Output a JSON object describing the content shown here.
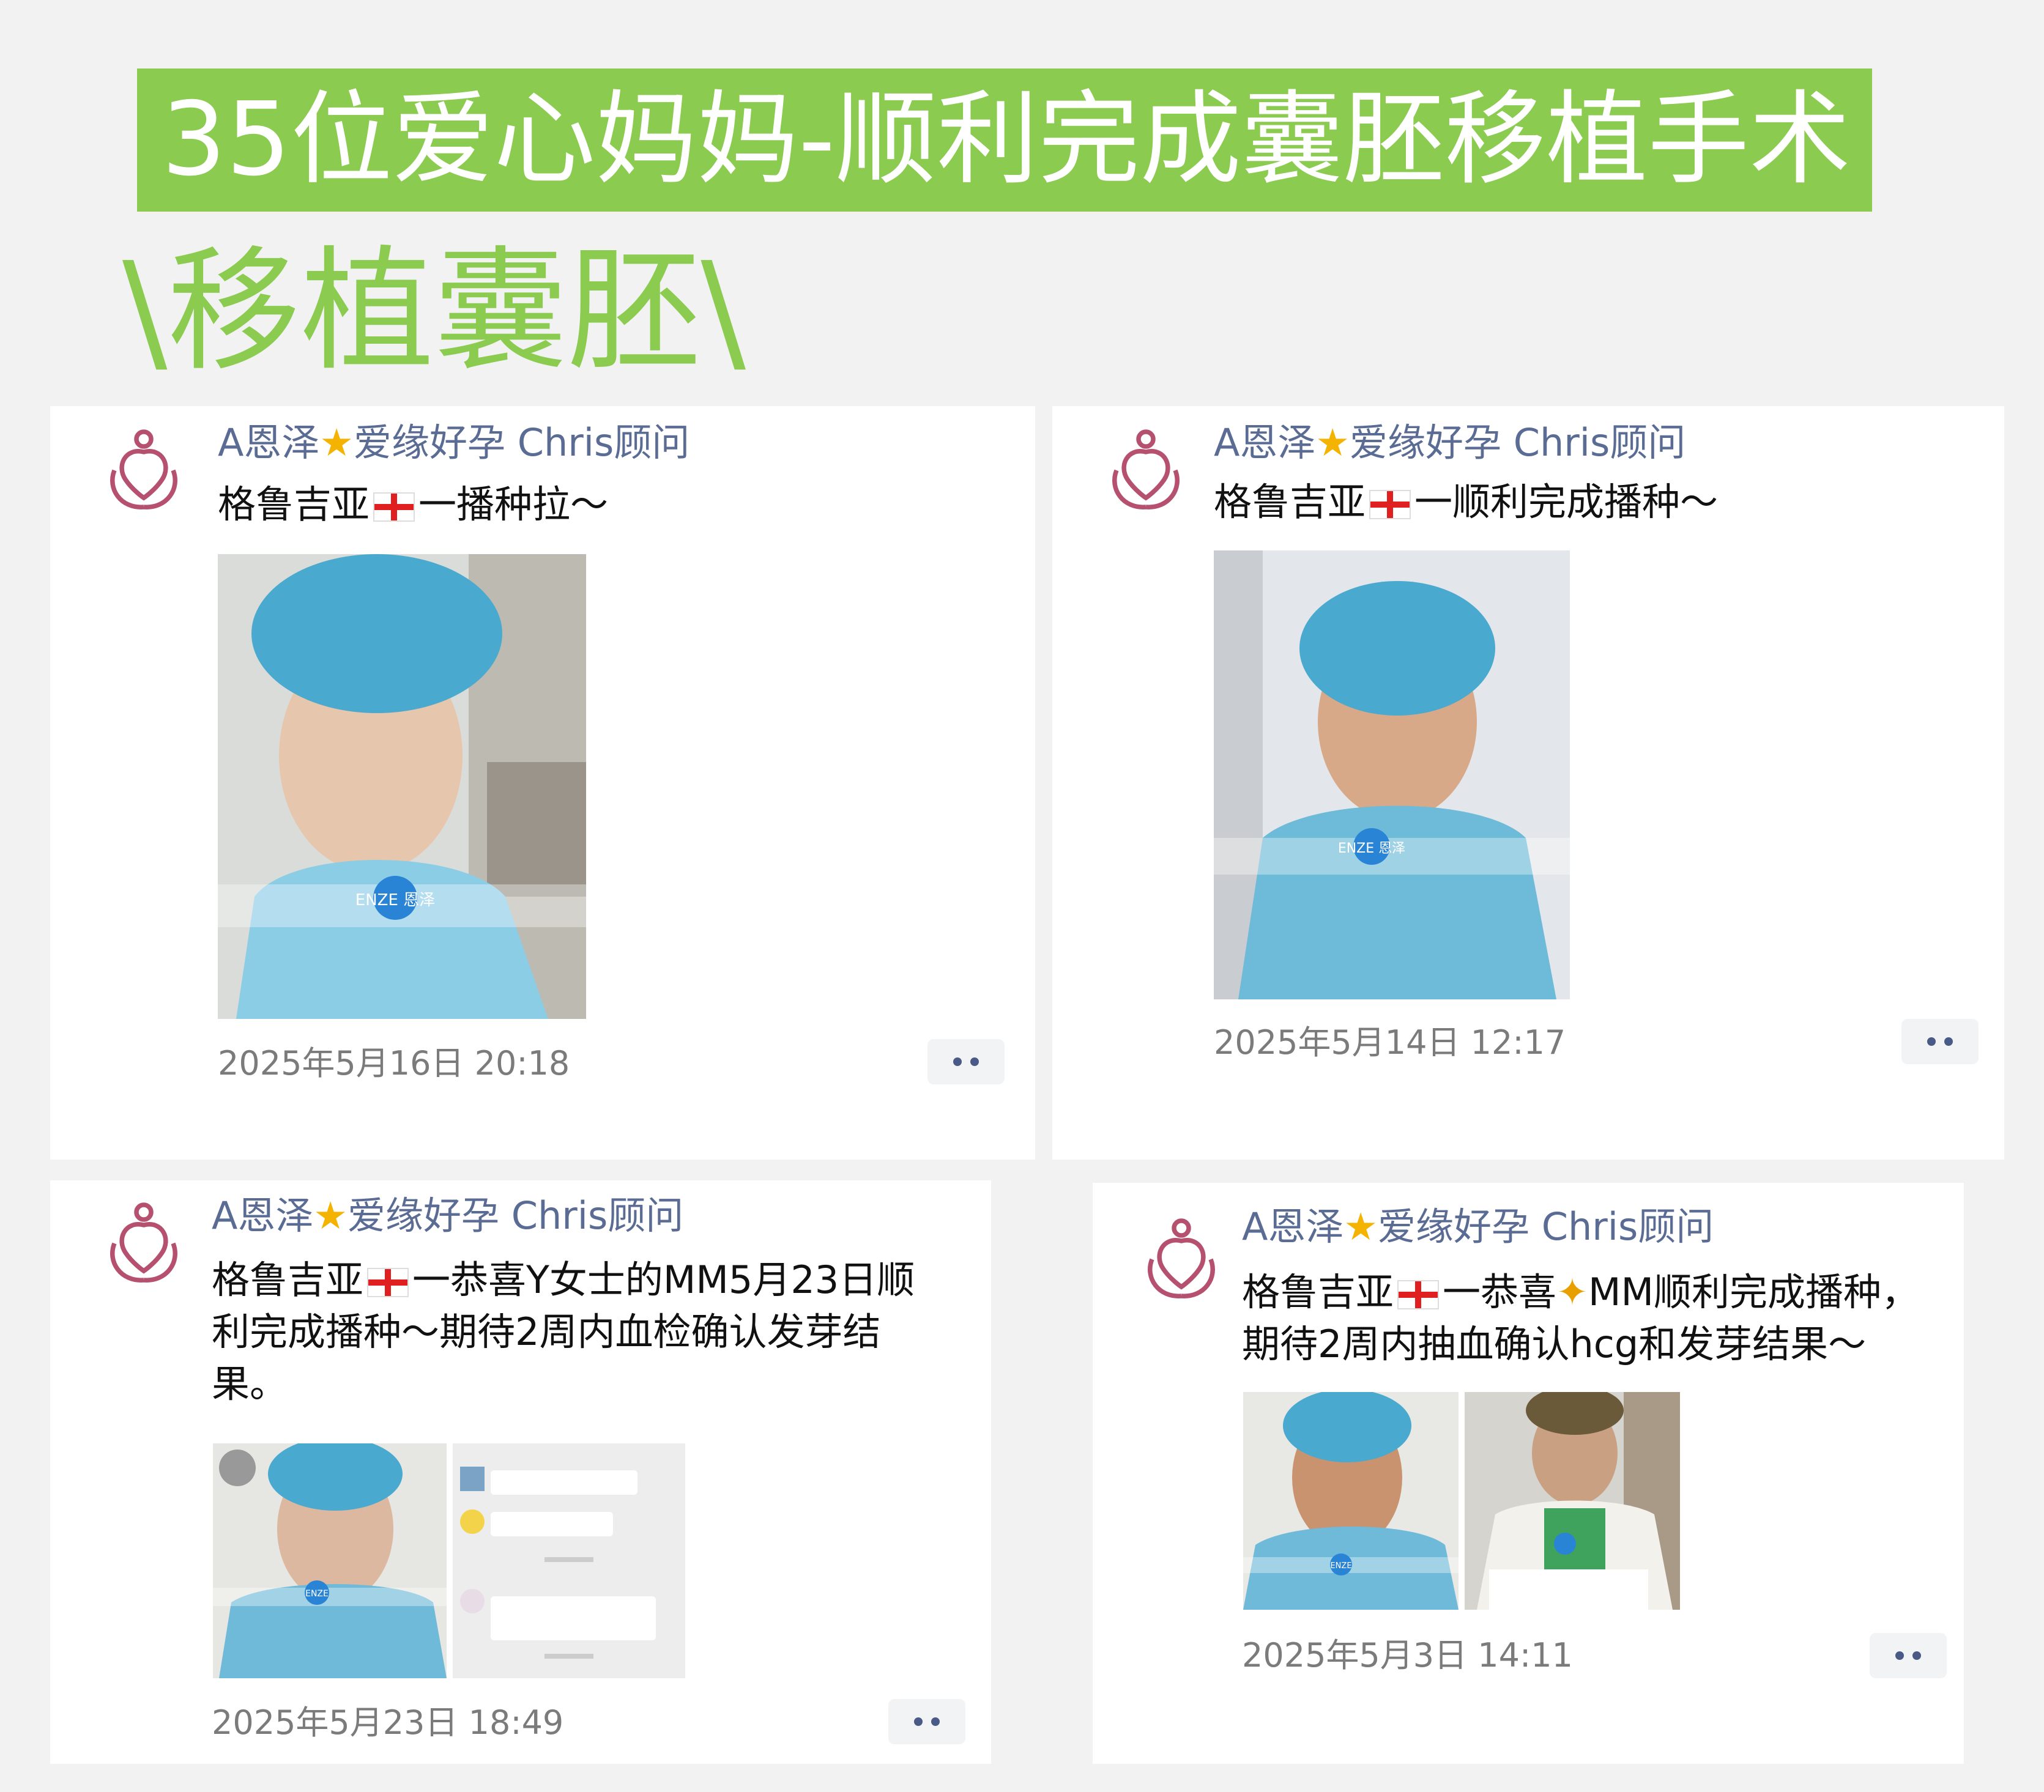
{
  "banner": {
    "title": "35位爱心妈妈-顺利完成囊胚移植手术"
  },
  "section": {
    "heading": "\\移植囊胚\\"
  },
  "colors": {
    "accent": "#8bcb4f",
    "author": "#5a6b94",
    "surgical_blue": "#5fb3d6"
  },
  "posts": [
    {
      "author": {
        "prefix": "A恩泽",
        "star_icon": "star-icon",
        "suffix": "爱缘好孕 Chris顾问"
      },
      "text_before": "格鲁吉亚",
      "flag_icon": "georgia-flag-icon",
      "text_after": "一播种拉～",
      "photo_watermark": "ENZE 恩泽",
      "time": "2025年5月16日 20:18"
    },
    {
      "author": {
        "prefix": "A恩泽",
        "star_icon": "star-icon",
        "suffix": "爱缘好孕 Chris顾问"
      },
      "text_before": "格鲁吉亚",
      "flag_icon": "georgia-flag-icon",
      "text_after": "一顺利完成播种～",
      "photo_watermark": "ENZE 恩泽",
      "time": "2025年5月14日 12:17"
    },
    {
      "author": {
        "prefix": "A恩泽",
        "star_icon": "star-icon",
        "suffix": "爱缘好孕 Chris顾问"
      },
      "text_before": "格鲁吉亚",
      "flag_icon": "georgia-flag-icon",
      "text_after": "一恭喜Y女士的MM5月23日顺利完成播种～期待2周内血检确认发芽结果。",
      "photo_watermark": "ENZE",
      "time": "2025年5月23日 18:49"
    },
    {
      "author": {
        "prefix": "A恩泽",
        "star_icon": "star-icon",
        "suffix": "爱缘好孕 Chris顾问"
      },
      "text_before": "格鲁吉亚",
      "flag_icon": "georgia-flag-icon",
      "text_middle": "一恭喜",
      "party_icon": "party-popper-icon",
      "text_after": "MM顺利完成播种，期待2周内抽血确认hcg和发芽结果～",
      "photo_watermark": "ENZE",
      "time": "2025年5月3日 14:11"
    }
  ]
}
